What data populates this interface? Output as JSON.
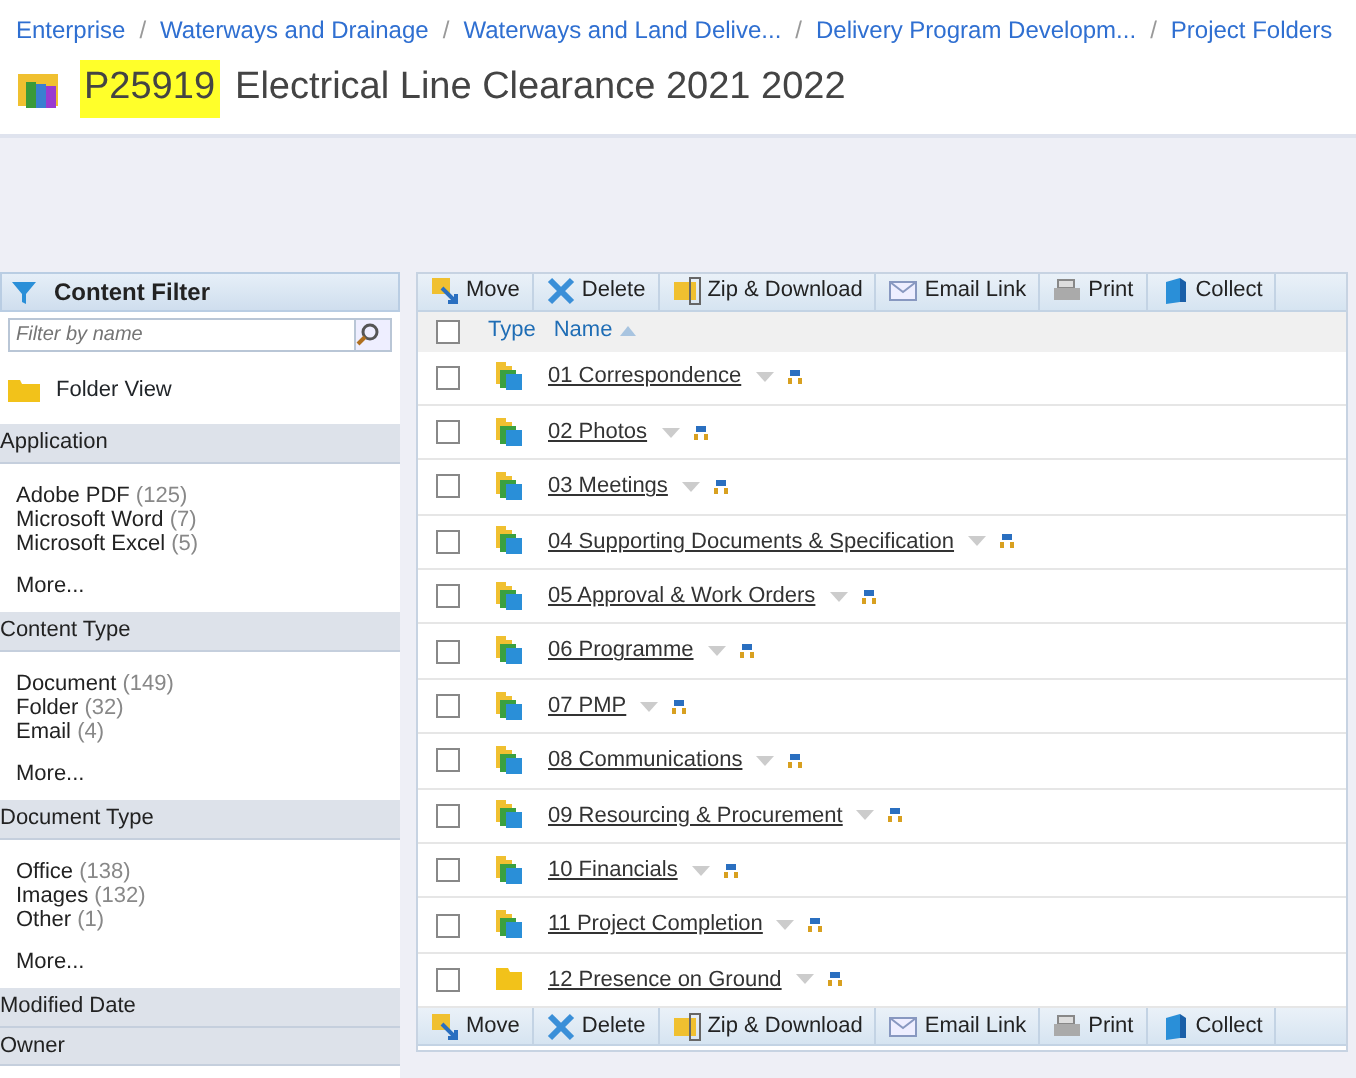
{
  "breadcrumb": [
    {
      "label": "Enterprise"
    },
    {
      "separator": "/",
      "label": "Waterways and Drainage"
    },
    {
      "separator": "/",
      "label": "Waterways and Land Delive..."
    },
    {
      "separator": "/",
      "label": "Delivery Program Developm..."
    },
    {
      "separator": "/",
      "label": "Project Folders"
    }
  ],
  "title": {
    "highlight": "P25919",
    "text": "Electrical Line Clearance 2021 2022"
  },
  "sidebar": {
    "title": "Content Filter",
    "filter": {
      "placeholder": "Filter by name"
    },
    "folder_view": "Folder View",
    "sections": [
      {
        "heading": "Application",
        "items": [
          {
            "label": "Adobe PDF",
            "count": "(125)"
          },
          {
            "label": "Microsoft Word",
            "count": "(7)"
          },
          {
            "label": "Microsoft Excel",
            "count": "(5)"
          }
        ],
        "more": "More..."
      },
      {
        "heading": "Content Type",
        "items": [
          {
            "label": "Document",
            "count": "(149)"
          },
          {
            "label": "Folder",
            "count": "(32)"
          },
          {
            "label": "Email",
            "count": "(4)"
          }
        ],
        "more": "More..."
      },
      {
        "heading": "Document Type",
        "items": [
          {
            "label": "Office",
            "count": "(138)"
          },
          {
            "label": "Images",
            "count": "(132)"
          },
          {
            "label": "Other",
            "count": "(1)"
          }
        ],
        "more": "More..."
      },
      {
        "heading": "Modified Date"
      },
      {
        "heading": "Owner"
      }
    ]
  },
  "toolbar": [
    {
      "kind": "move",
      "label": "Move"
    },
    {
      "kind": "delete",
      "label": "Delete"
    },
    {
      "kind": "zip",
      "label": "Zip & Download"
    },
    {
      "kind": "email",
      "label": "Email Link"
    },
    {
      "kind": "print",
      "label": "Print"
    },
    {
      "kind": "collect",
      "label": "Collect"
    }
  ],
  "table": {
    "select_all_checked": false,
    "columns": [
      "Type",
      "Name"
    ],
    "rows": [
      {
        "kind": "project",
        "name": "01 Correspondence",
        "checked": false
      },
      {
        "kind": "project",
        "name": "02 Photos",
        "checked": false
      },
      {
        "kind": "project",
        "name": "03 Meetings",
        "checked": false
      },
      {
        "kind": "project",
        "name": "04 Supporting Documents & Specification",
        "checked": false
      },
      {
        "kind": "project",
        "name": "05 Approval & Work Orders",
        "checked": false
      },
      {
        "kind": "project",
        "name": "06 Programme",
        "checked": false
      },
      {
        "kind": "project",
        "name": "07 PMP",
        "checked": false
      },
      {
        "kind": "project",
        "name": "08 Communications",
        "checked": false
      },
      {
        "kind": "project",
        "name": "09 Resourcing & Procurement",
        "checked": false
      },
      {
        "kind": "project",
        "name": "10 Financials",
        "checked": false
      },
      {
        "kind": "project",
        "name": "11 Project Completion",
        "checked": false
      },
      {
        "kind": "folder",
        "name": "12 Presence on Ground",
        "checked": false
      }
    ]
  },
  "bottom_toolbar": [
    {
      "kind": "move",
      "label": "Move"
    },
    {
      "kind": "delete",
      "label": "Delete"
    },
    {
      "kind": "zip",
      "label": "Zip & Download"
    },
    {
      "kind": "email",
      "label": "Email Link"
    },
    {
      "kind": "print",
      "label": "Print"
    },
    {
      "kind": "collect",
      "label": "Collect"
    }
  ]
}
